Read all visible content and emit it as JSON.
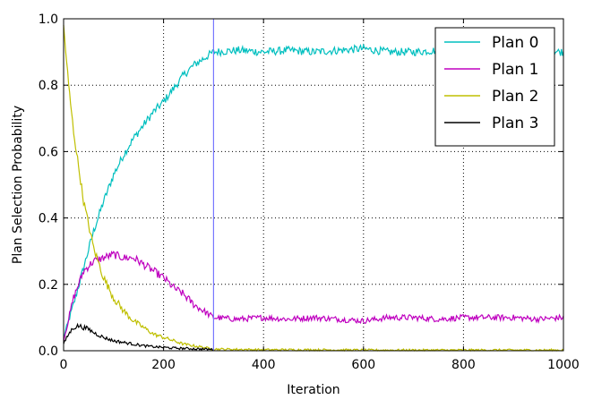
{
  "chart_data": {
    "type": "line",
    "xlabel": "Iteration",
    "ylabel": "Plan Selection Probability",
    "xlim": [
      0,
      1000
    ],
    "ylim": [
      0,
      1.0
    ],
    "xticks": [
      "0",
      "200",
      "400",
      "600",
      "800",
      "1000"
    ],
    "xtick_values": [
      0,
      200,
      400,
      600,
      800,
      1000
    ],
    "yticks": [
      "0.0",
      "0.2",
      "0.4",
      "0.6",
      "0.8",
      "1.0"
    ],
    "ytick_values": [
      0,
      0.2,
      0.4,
      0.6,
      0.8,
      1.0
    ],
    "grid": true,
    "legend_position": "top-right",
    "vertical_marker": {
      "x": 300,
      "color": "#7777ff"
    },
    "series": [
      {
        "name": "Plan 0",
        "color": "#00bfbf",
        "x": [
          0,
          20,
          40,
          60,
          80,
          100,
          120,
          140,
          160,
          180,
          200,
          220,
          240,
          260,
          280,
          300,
          350,
          400,
          450,
          500,
          550,
          600,
          650,
          700,
          750,
          800,
          850,
          900,
          950,
          1000
        ],
        "y": [
          0.04,
          0.14,
          0.25,
          0.36,
          0.45,
          0.53,
          0.59,
          0.64,
          0.68,
          0.72,
          0.75,
          0.79,
          0.83,
          0.86,
          0.88,
          0.9,
          0.905,
          0.9,
          0.905,
          0.9,
          0.905,
          0.91,
          0.9,
          0.9,
          0.905,
          0.9,
          0.9,
          0.9,
          0.905,
          0.9
        ]
      },
      {
        "name": "Plan 1",
        "color": "#bf00bf",
        "x": [
          0,
          20,
          40,
          60,
          80,
          100,
          120,
          140,
          160,
          180,
          200,
          220,
          240,
          260,
          280,
          300,
          350,
          400,
          450,
          500,
          550,
          600,
          650,
          700,
          750,
          800,
          850,
          900,
          950,
          1000
        ],
        "y": [
          0.03,
          0.16,
          0.24,
          0.27,
          0.28,
          0.29,
          0.28,
          0.28,
          0.26,
          0.24,
          0.22,
          0.19,
          0.17,
          0.14,
          0.12,
          0.1,
          0.095,
          0.1,
          0.095,
          0.1,
          0.095,
          0.09,
          0.1,
          0.1,
          0.095,
          0.1,
          0.1,
          0.1,
          0.095,
          0.1
        ]
      },
      {
        "name": "Plan 2",
        "color": "#bfbf00",
        "x": [
          0,
          10,
          20,
          40,
          60,
          80,
          100,
          120,
          140,
          160,
          180,
          200,
          220,
          240,
          260,
          280,
          300,
          400,
          500,
          600,
          700,
          800,
          900,
          1000
        ],
        "y": [
          0.98,
          0.8,
          0.66,
          0.45,
          0.31,
          0.22,
          0.16,
          0.12,
          0.09,
          0.07,
          0.05,
          0.04,
          0.03,
          0.02,
          0.015,
          0.01,
          0.005,
          0.003,
          0.003,
          0.002,
          0.002,
          0.002,
          0.002,
          0.002
        ]
      },
      {
        "name": "Plan 3",
        "color": "#000000",
        "x": [
          0,
          10,
          20,
          30,
          40,
          50,
          60,
          80,
          100,
          120,
          140,
          160,
          180,
          200,
          220,
          240,
          260,
          280,
          300
        ],
        "y": [
          0.02,
          0.05,
          0.07,
          0.075,
          0.07,
          0.065,
          0.055,
          0.04,
          0.03,
          0.025,
          0.02,
          0.015,
          0.012,
          0.01,
          0.008,
          0.007,
          0.006,
          0.005,
          0.004
        ]
      }
    ]
  }
}
